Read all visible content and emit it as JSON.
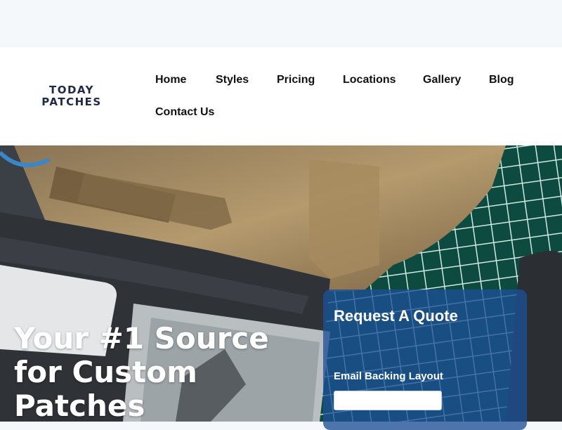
{
  "brand": {
    "logo_line1": "TODAY",
    "logo_line2": "PATCHES"
  },
  "nav": [
    {
      "label": "Home"
    },
    {
      "label": "Styles"
    },
    {
      "label": "Pricing"
    },
    {
      "label": "Locations"
    },
    {
      "label": "Gallery"
    },
    {
      "label": "Blog"
    },
    {
      "label": "Contact Us"
    }
  ],
  "hero": {
    "headline": [
      "Your #1 Source",
      "for Custom",
      "Patches"
    ]
  },
  "quote_form": {
    "title": "Request A Quote",
    "field_label": "Email Backing Layout",
    "field_value": ""
  },
  "colors": {
    "brand_navy": "#1f2a44",
    "quote_panel": "#1e5096",
    "header_bg": "#ffffff",
    "topbar_bg": "#f5f8fb"
  }
}
